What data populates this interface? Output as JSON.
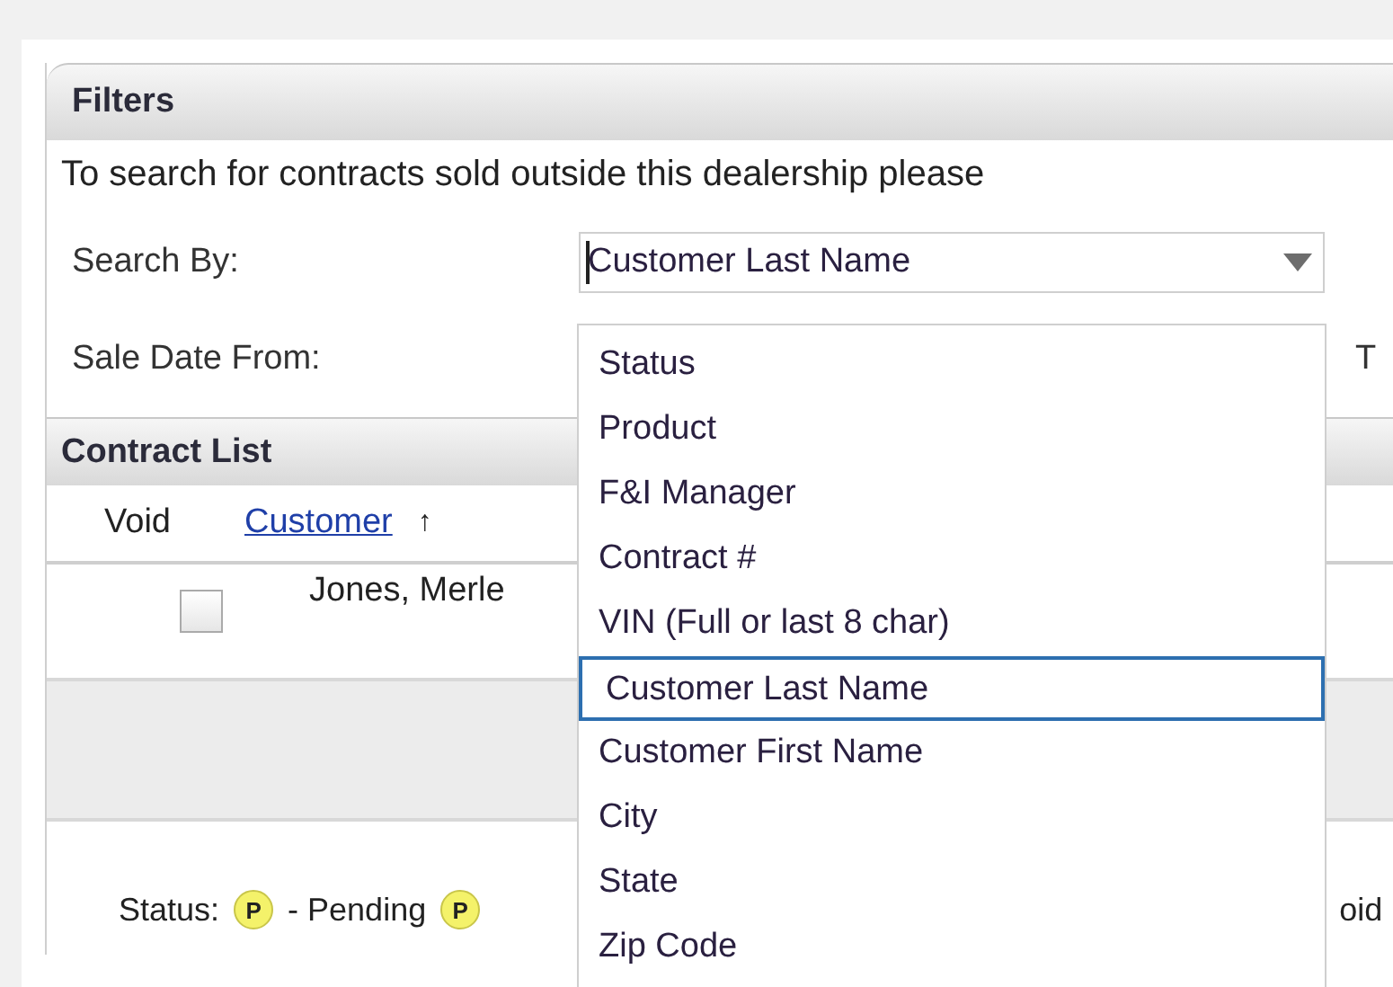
{
  "panel_title": "Filters",
  "notice": "To search for contracts sold outside this dealership please",
  "search_by": {
    "label": "Search By:",
    "value": "Customer Last Name",
    "expanded": true,
    "options": [
      {
        "label": "Status",
        "selected": false
      },
      {
        "label": "Product",
        "selected": false
      },
      {
        "label": "F&I Manager",
        "selected": false
      },
      {
        "label": "Contract #",
        "selected": false
      },
      {
        "label": "VIN (Full or last 8 char)",
        "selected": false
      },
      {
        "label": "Customer Last Name",
        "selected": true
      },
      {
        "label": "Customer First Name",
        "selected": false
      },
      {
        "label": "City",
        "selected": false
      },
      {
        "label": "State",
        "selected": false
      },
      {
        "label": "Zip Code",
        "selected": false
      }
    ]
  },
  "sale_date": {
    "label": "Sale Date From:",
    "to_label": "T"
  },
  "contract_list": {
    "title": "Contract List",
    "columns": [
      {
        "label": "Void",
        "kind": "plain"
      },
      {
        "label": "Customer",
        "kind": "sort-link",
        "sort_indicator": "↑"
      }
    ],
    "rows": [
      {
        "void": false,
        "customer": "Jones, Merle"
      }
    ]
  },
  "legend": {
    "label": "Status:",
    "items": [
      {
        "badge": "P",
        "text": "- Pending"
      },
      {
        "badge": "P"
      }
    ],
    "trailing": "oid"
  }
}
